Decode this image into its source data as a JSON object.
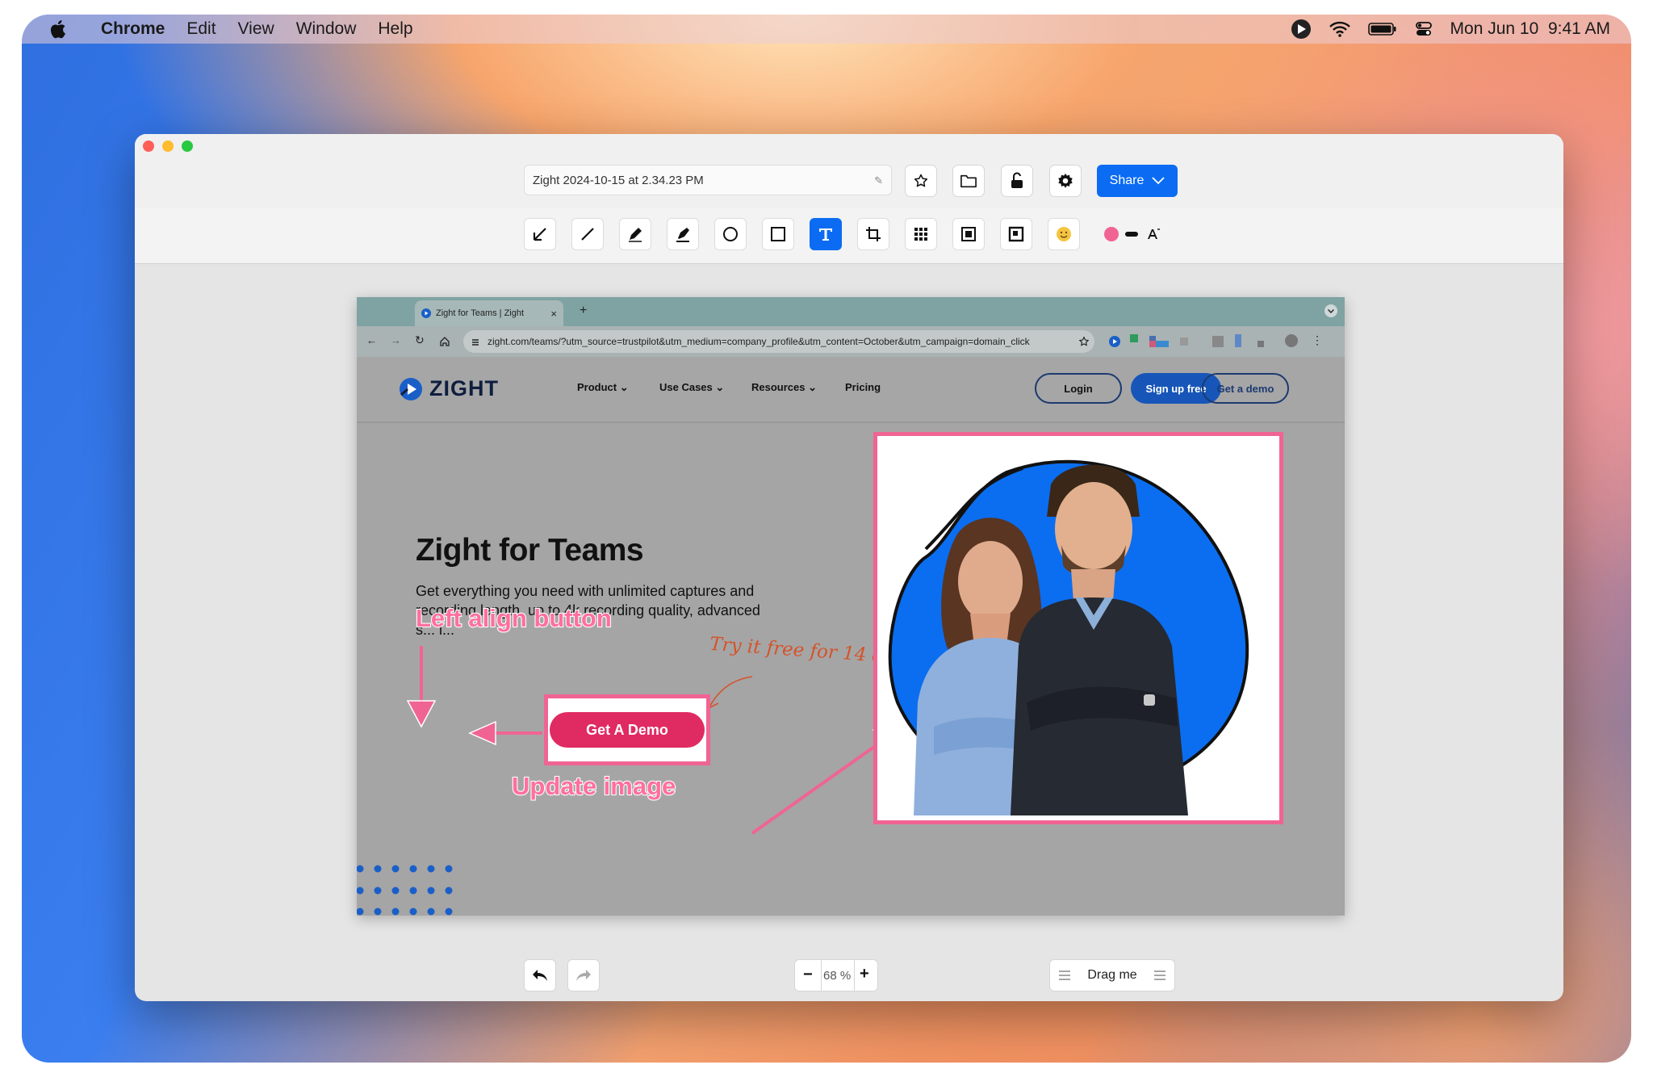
{
  "menubar": {
    "app": "Chrome",
    "items": [
      "Edit",
      "View",
      "Window",
      "Help"
    ],
    "clock": "Mon Jun 10  9:41 AM"
  },
  "editor": {
    "filename": "Zight 2024-10-15 at 2.34.23 PM",
    "share_label": "Share",
    "tools": [
      "arrow-tool",
      "line-tool",
      "pen-tool",
      "highlighter-tool",
      "ellipse-tool",
      "rectangle-tool",
      "text-tool",
      "crop-tool",
      "blur-tool",
      "spotlight-tool",
      "frame-tool",
      "emoji-tool"
    ],
    "active_tool": "text-tool",
    "annotation_color": "#f06493",
    "zoom_level": "68 %",
    "drag_label": "Drag me"
  },
  "screenshot": {
    "tab_title": "Zight for Teams | Zight",
    "url": "zight.com/teams/?utm_source=trustpilot&utm_medium=company_profile&utm_content=October&utm_campaign=domain_click",
    "logo": "ZIGHT",
    "nav": [
      "Product",
      "Use Cases",
      "Resources",
      "Pricing"
    ],
    "login_label": "Login",
    "signup_label": "Sign up free",
    "get_demo_label": "Get a demo",
    "headline": "Zight for Teams",
    "body_line1": "Get everything you need with unlimited captures and",
    "body_line2": "recording length, up to 4k recording quality, advanced",
    "body_line3": "s... i...",
    "cta_label": "Get A Demo"
  },
  "annotations": {
    "left_align": "Left align button",
    "try_free": "Try it free for 14 days!",
    "update_image": "Update image"
  },
  "colors": {
    "brand_blue": "#0b6cf3",
    "cta_pink": "#e02a62",
    "annotation_pink": "#f06493",
    "handwriting_orange": "#d5532a"
  }
}
